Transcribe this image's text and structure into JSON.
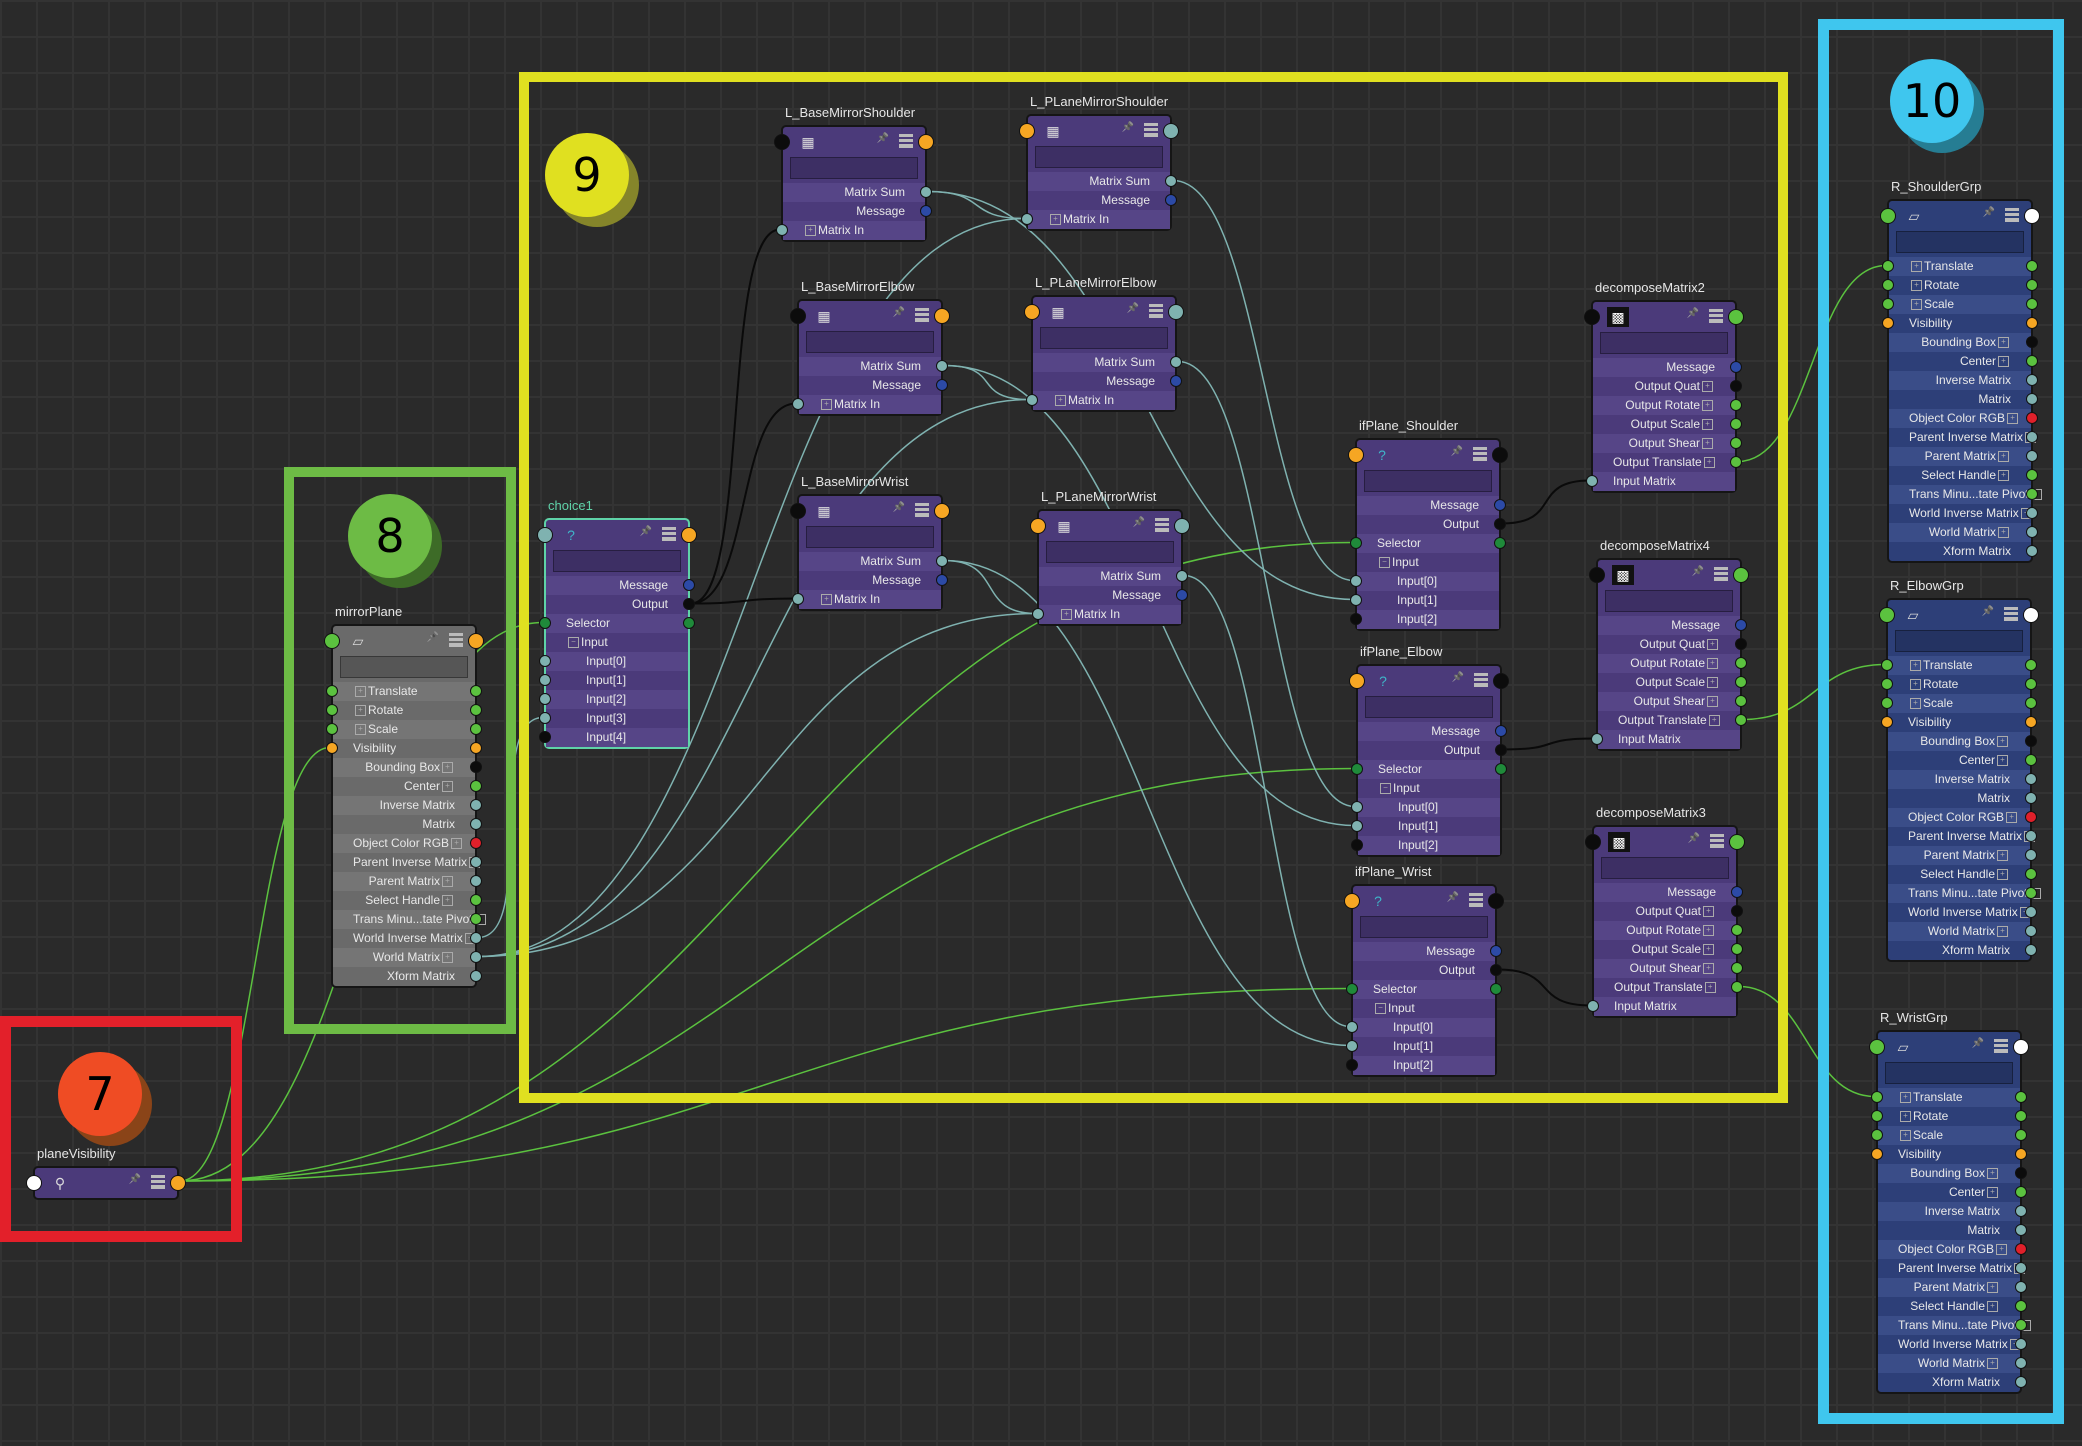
{
  "app": "Node Editor",
  "frames": [
    {
      "id": "frame-7",
      "label": "7",
      "color": "#e3202a",
      "badge_color": "#ef4c24"
    },
    {
      "id": "frame-8",
      "label": "8",
      "color": "#6dbb45",
      "badge_color": "#6dbb45"
    },
    {
      "id": "frame-9",
      "label": "9",
      "color": "#e0e020",
      "badge_color": "#e0e020"
    },
    {
      "id": "frame-10",
      "label": "10",
      "color": "#3fc6ee",
      "badge_color": "#3fc6ee"
    }
  ],
  "port_colors": {
    "green": "#5bc23f",
    "orange": "#f6a623",
    "black": "#0c0c0c",
    "teal": "#7fb2b0",
    "navy": "#2c4aa6",
    "red": "#e0202a",
    "white": "#ffffff",
    "darkgreen": "#1f8a3a"
  },
  "nodes": {
    "planeVisibility": {
      "title": "planeVisibility",
      "icon": "condition-icon",
      "rows": []
    },
    "mirrorPlane": {
      "title": "mirrorPlane",
      "icon": "transform-icon",
      "rows": [
        "Translate",
        "Rotate",
        "Scale",
        "Visibility",
        "Bounding Box",
        "Center",
        "Inverse Matrix",
        "Matrix",
        "Object Color RGB",
        "Parent Inverse Matrix",
        "Parent Matrix",
        "Select Handle",
        "Trans Minu...tate Pivot",
        "World Inverse Matrix",
        "World Matrix",
        "Xform Matrix"
      ]
    },
    "choice1": {
      "title": "choice1",
      "icon": "choice-icon",
      "rows": [
        "Message",
        "Output",
        "Selector",
        "Input",
        "Input[0]",
        "Input[1]",
        "Input[2]",
        "Input[3]",
        "Input[4]"
      ]
    },
    "L_BaseMirrorShoulder": {
      "title": "L_BaseMirrorShoulder",
      "icon": "matrix-icon",
      "rows": [
        "Matrix Sum",
        "Message",
        "Matrix In"
      ]
    },
    "L_PLaneMirrorShoulder": {
      "title": "L_PLaneMirrorShoulder",
      "icon": "matrix-icon",
      "rows": [
        "Matrix Sum",
        "Message",
        "Matrix In"
      ]
    },
    "L_BaseMirrorElbow": {
      "title": "L_BaseMirrorElbow",
      "icon": "matrix-icon",
      "rows": [
        "Matrix Sum",
        "Message",
        "Matrix In"
      ]
    },
    "L_PLaneMirrorElbow": {
      "title": "L_PLaneMirrorElbow",
      "icon": "matrix-icon",
      "rows": [
        "Matrix Sum",
        "Message",
        "Matrix In"
      ]
    },
    "L_BaseMirrorWrist": {
      "title": "L_BaseMirrorWrist",
      "icon": "matrix-icon",
      "rows": [
        "Matrix Sum",
        "Message",
        "Matrix In"
      ]
    },
    "L_PLaneMirrorWrist": {
      "title": "L_PLaneMirrorWrist",
      "icon": "matrix-icon",
      "rows": [
        "Matrix Sum",
        "Message",
        "Matrix In"
      ]
    },
    "ifPlane_Shoulder": {
      "title": "ifPlane_Shoulder",
      "icon": "choice-icon",
      "rows": [
        "Message",
        "Output",
        "Selector",
        "Input",
        "Input[0]",
        "Input[1]",
        "Input[2]"
      ]
    },
    "ifPlane_Elbow": {
      "title": "ifPlane_Elbow",
      "icon": "choice-icon",
      "rows": [
        "Message",
        "Output",
        "Selector",
        "Input",
        "Input[0]",
        "Input[1]",
        "Input[2]"
      ]
    },
    "ifPlane_Wrist": {
      "title": "ifPlane_Wrist",
      "icon": "choice-icon",
      "rows": [
        "Message",
        "Output",
        "Selector",
        "Input",
        "Input[0]",
        "Input[1]",
        "Input[2]"
      ]
    },
    "decomposeMatrix2": {
      "title": "decomposeMatrix2",
      "icon": "decompose-icon",
      "rows": [
        "Message",
        "Output Quat",
        "Output Rotate",
        "Output Scale",
        "Output Shear",
        "Output Translate",
        "Input Matrix"
      ]
    },
    "decomposeMatrix4": {
      "title": "decomposeMatrix4",
      "icon": "decompose-icon",
      "rows": [
        "Message",
        "Output Quat",
        "Output Rotate",
        "Output Scale",
        "Output Shear",
        "Output Translate",
        "Input Matrix"
      ]
    },
    "decomposeMatrix3": {
      "title": "decomposeMatrix3",
      "icon": "decompose-icon",
      "rows": [
        "Message",
        "Output Quat",
        "Output Rotate",
        "Output Scale",
        "Output Shear",
        "Output Translate",
        "Input Matrix"
      ]
    },
    "R_ShoulderGrp": {
      "title": "R_ShoulderGrp",
      "icon": "transform-icon",
      "rows": [
        "Translate",
        "Rotate",
        "Scale",
        "Visibility",
        "Bounding Box",
        "Center",
        "Inverse Matrix",
        "Matrix",
        "Object Color RGB",
        "Parent Inverse Matrix",
        "Parent Matrix",
        "Select Handle",
        "Trans Minu...tate Pivot",
        "World Inverse Matrix",
        "World Matrix",
        "Xform Matrix"
      ]
    },
    "R_ElbowGrp": {
      "title": "R_ElbowGrp",
      "icon": "transform-icon",
      "rows": [
        "Translate",
        "Rotate",
        "Scale",
        "Visibility",
        "Bounding Box",
        "Center",
        "Inverse Matrix",
        "Matrix",
        "Object Color RGB",
        "Parent Inverse Matrix",
        "Parent Matrix",
        "Select Handle",
        "Trans Minu...tate Pivot",
        "World Inverse Matrix",
        "World Matrix",
        "Xform Matrix"
      ]
    },
    "R_WristGrp": {
      "title": "R_WristGrp",
      "icon": "transform-icon",
      "rows": [
        "Translate",
        "Rotate",
        "Scale",
        "Visibility",
        "Bounding Box",
        "Center",
        "Inverse Matrix",
        "Matrix",
        "Object Color RGB",
        "Parent Inverse Matrix",
        "Parent Matrix",
        "Select Handle",
        "Trans Minu...tate Pivot",
        "World Inverse Matrix",
        "World Matrix",
        "Xform Matrix"
      ]
    }
  },
  "connections": [
    {
      "from": "planeVisibility.out",
      "to": "mirrorPlane.Visibility",
      "color": "green"
    },
    {
      "from": "planeVisibility.out",
      "to": "choice1.Selector",
      "color": "green"
    },
    {
      "from": "planeVisibility.out",
      "to": "ifPlane_Shoulder.Selector",
      "color": "green"
    },
    {
      "from": "planeVisibility.out",
      "to": "ifPlane_Elbow.Selector",
      "color": "green"
    },
    {
      "from": "planeVisibility.out",
      "to": "ifPlane_Wrist.Selector",
      "color": "green"
    },
    {
      "from": "mirrorPlane.World Matrix",
      "to": "L_PLaneMirrorShoulder.Matrix In",
      "color": "teal"
    },
    {
      "from": "mirrorPlane.World Matrix",
      "to": "L_PLaneMirrorElbow.Matrix In",
      "color": "teal"
    },
    {
      "from": "mirrorPlane.World Matrix",
      "to": "L_PLaneMirrorWrist.Matrix In",
      "color": "teal"
    },
    {
      "from": "mirrorPlane.World Inverse Matrix",
      "to": "choice1.Input[3]",
      "color": "teal"
    },
    {
      "from": "choice1.Output",
      "to": "L_BaseMirrorShoulder.Matrix In",
      "color": "black"
    },
    {
      "from": "choice1.Output",
      "to": "L_BaseMirrorElbow.Matrix In",
      "color": "black"
    },
    {
      "from": "choice1.Output",
      "to": "L_BaseMirrorWrist.Matrix In",
      "color": "black"
    },
    {
      "from": "L_BaseMirrorShoulder.Matrix Sum",
      "to": "L_PLaneMirrorShoulder.Matrix In",
      "color": "teal"
    },
    {
      "from": "L_BaseMirrorElbow.Matrix Sum",
      "to": "L_PLaneMirrorElbow.Matrix In",
      "color": "teal"
    },
    {
      "from": "L_BaseMirrorWrist.Matrix Sum",
      "to": "L_PLaneMirrorWrist.Matrix In",
      "color": "teal"
    },
    {
      "from": "L_BaseMirrorShoulder.Matrix Sum",
      "to": "ifPlane_Shoulder.Input[1]",
      "color": "teal"
    },
    {
      "from": "L_PLaneMirrorShoulder.Matrix Sum",
      "to": "ifPlane_Shoulder.Input[0]",
      "color": "teal"
    },
    {
      "from": "L_BaseMirrorElbow.Matrix Sum",
      "to": "ifPlane_Elbow.Input[1]",
      "color": "teal"
    },
    {
      "from": "L_PLaneMirrorElbow.Matrix Sum",
      "to": "ifPlane_Elbow.Input[0]",
      "color": "teal"
    },
    {
      "from": "L_BaseMirrorWrist.Matrix Sum",
      "to": "ifPlane_Wrist.Input[1]",
      "color": "teal"
    },
    {
      "from": "L_PLaneMirrorWrist.Matrix Sum",
      "to": "ifPlane_Wrist.Input[0]",
      "color": "teal"
    },
    {
      "from": "ifPlane_Shoulder.Output",
      "to": "decomposeMatrix2.Input Matrix",
      "color": "black"
    },
    {
      "from": "ifPlane_Elbow.Output",
      "to": "decomposeMatrix4.Input Matrix",
      "color": "black"
    },
    {
      "from": "ifPlane_Wrist.Output",
      "to": "decomposeMatrix3.Input Matrix",
      "color": "black"
    },
    {
      "from": "decomposeMatrix2.Output Translate",
      "to": "R_ShoulderGrp.Translate",
      "color": "green"
    },
    {
      "from": "decomposeMatrix4.Output Translate",
      "to": "R_ElbowGrp.Translate",
      "color": "green"
    },
    {
      "from": "decomposeMatrix3.Output Translate",
      "to": "R_WristGrp.Translate",
      "color": "green"
    }
  ]
}
